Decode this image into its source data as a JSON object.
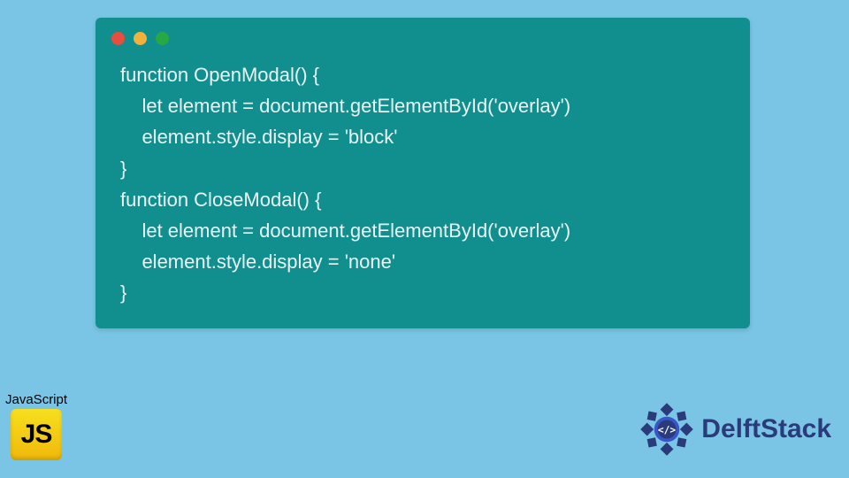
{
  "code": {
    "lines": [
      "function OpenModal() {",
      "    let element = document.getElementById('overlay')",
      "    element.style.display = 'block'",
      "}",
      "function CloseModal() {",
      "    let element = document.getElementById('overlay')",
      "    element.style.display = 'none'",
      "}"
    ]
  },
  "js_badge": {
    "label": "JavaScript",
    "icon_text": "JS"
  },
  "brand": {
    "name": "DelftStack"
  }
}
